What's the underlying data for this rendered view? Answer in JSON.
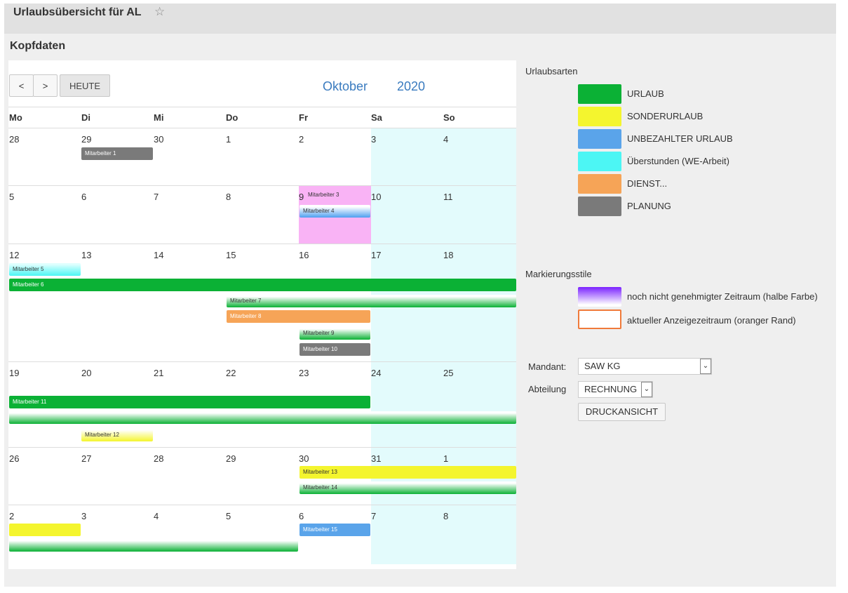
{
  "page": {
    "title": "Urlaubsübersicht für AL",
    "section_title": "Kopfdaten"
  },
  "toolbar": {
    "prev_label": "<",
    "next_label": ">",
    "today_label": "HEUTE",
    "month": "Oktober",
    "year": "2020"
  },
  "weekdays": [
    "Mo",
    "Di",
    "Mi",
    "Do",
    "Fr",
    "Sa",
    "So"
  ],
  "weeks": [
    [
      "28",
      "29",
      "30",
      "1",
      "2",
      "3",
      "4"
    ],
    [
      "5",
      "6",
      "7",
      "8",
      "9",
      "10",
      "11"
    ],
    [
      "12",
      "13",
      "14",
      "15",
      "16",
      "17",
      "18"
    ],
    [
      "19",
      "20",
      "21",
      "22",
      "23",
      "24",
      "25"
    ],
    [
      "26",
      "27",
      "28",
      "29",
      "30",
      "31",
      "1"
    ],
    [
      "2",
      "3",
      "4",
      "5",
      "6",
      "7",
      "8"
    ]
  ],
  "events": [
    {
      "label": "Mitarbeiter 1",
      "type": "PLANUNG"
    },
    {
      "label": "Mitarbeiter 3",
      "type": "noch nicht genehmigt"
    },
    {
      "label": "Mitarbeiter 4",
      "type": "UNBEZAHLTER URLAUB"
    },
    {
      "label": "Mitarbeiter 5",
      "type": "Überstunden"
    },
    {
      "label": "Mitarbeiter 6",
      "type": "URLAUB"
    },
    {
      "label": "Mitarbeiter 7",
      "type": "URLAUB"
    },
    {
      "label": "Mitarbeiter 8",
      "type": "DIENST"
    },
    {
      "label": "Mitarbeiter 9",
      "type": "URLAUB"
    },
    {
      "label": "Mitarbeiter 10",
      "type": "PLANUNG"
    },
    {
      "label": "Mitarbeiter 11",
      "type": "URLAUB"
    },
    {
      "label": "Mitarbeiter 12",
      "type": "SONDERURLAUB"
    },
    {
      "label": "Mitarbeiter 13",
      "type": "SONDERURLAUB"
    },
    {
      "label": "Mitarbeiter 14",
      "type": "URLAUB"
    },
    {
      "label": "Mitarbeiter 15",
      "type": "UNBEZAHLTER URLAUB"
    }
  ],
  "legend": {
    "title": "Urlaubsarten",
    "items": [
      {
        "label": "URLAUB",
        "color": "#0bb135"
      },
      {
        "label": "SONDERURLAUB",
        "color": "#f4f52e"
      },
      {
        "label": "UNBEZAHLTER URLAUB",
        "color": "#5aa4ea"
      },
      {
        "label": "Überstunden (WE-Arbeit)",
        "color": "#4cf6f4"
      },
      {
        "label": "DIENST...",
        "color": "#f6a457"
      },
      {
        "label": "PLANUNG",
        "color": "#7a7a7a"
      }
    ]
  },
  "styles": {
    "title": "Markierungsstile",
    "items": [
      {
        "label": "noch nicht genehmigter Zeitraum (halbe Farbe)"
      },
      {
        "label": "aktueller Anzeigezeitraum (oranger Rand)"
      }
    ]
  },
  "form": {
    "mandant_label": "Mandant:",
    "mandant_value": "SAW KG",
    "abteilung_label": "Abteilung",
    "abteilung_value": "RECHNUNG",
    "print_label": "DRUCKANSICHT"
  },
  "colors": {
    "accent": "#3a7bbf",
    "weekend": "#e3fbfc",
    "highlight_border": "#f07a3a"
  }
}
